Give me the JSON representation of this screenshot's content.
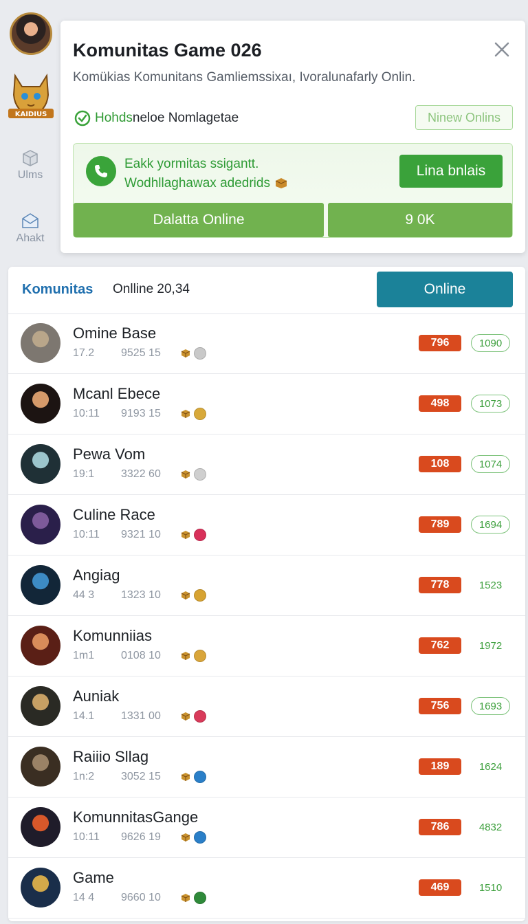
{
  "rail": {
    "items": [
      {
        "label": "Ulms",
        "icon": "box-icon"
      },
      {
        "label": "Ahakt",
        "icon": "envelope-icon"
      }
    ]
  },
  "popup": {
    "title": "Komunitas Game 026",
    "description": "Komükias Komunitans Gamliemssixaı, Ivoralunafarly Onlin.",
    "status_prefix": "Hohds",
    "status_text": "neloe Nomlagetae",
    "view_button": "Ninew Onlins",
    "inner_line1": "Eakk yormitas ssigantt.",
    "inner_line2": "Wodhllaghawax adedrids",
    "join_button": "Lina bnlais",
    "bar_button_1": "Dalatta Online",
    "bar_button_2": "9 0K"
  },
  "panel": {
    "title": "Komunitas",
    "count": "Onlline 20,34",
    "online_button": "Online"
  },
  "members": [
    {
      "name": "Omine Base",
      "m1": "17.2",
      "m2": "9525 15",
      "score": "796",
      "stat": "1090",
      "pill": true,
      "dot": "#c9c9c9",
      "av": [
        "#7d7770",
        "#b9a68a"
      ]
    },
    {
      "name": "Mcanl Ebece",
      "m1": "10:11",
      "m2": "9193 15",
      "score": "498",
      "stat": "1073",
      "pill": true,
      "dot": "#d8a93a",
      "av": [
        "#1c1412",
        "#d59a6a"
      ]
    },
    {
      "name": "Pewa Vom",
      "m1": "19:1",
      "m2": "3322 60",
      "score": "108",
      "stat": "1074",
      "pill": true,
      "dot": "#cfcfcf",
      "av": [
        "#1f3036",
        "#9cc5cc"
      ]
    },
    {
      "name": "Culine Race",
      "m1": "10:11",
      "m2": "9321 10",
      "score": "789",
      "stat": "1694",
      "pill": true,
      "dot": "#d8305a",
      "av": [
        "#2a1f4a",
        "#7d5a9a"
      ]
    },
    {
      "name": "Angiag",
      "m1": "44 3",
      "m2": "1323 10",
      "score": "778",
      "stat": "1523",
      "pill": false,
      "dot": "#d7a332",
      "av": [
        "#122638",
        "#3d8bc4"
      ]
    },
    {
      "name": "Komunniias",
      "m1": "1m1",
      "m2": "0108 10",
      "score": "762",
      "stat": "1972",
      "pill": false,
      "dot": "#d9a53a",
      "av": [
        "#5a1f16",
        "#d98c5a"
      ]
    },
    {
      "name": "Auniak",
      "m1": "14.1",
      "m2": "1331 00",
      "score": "756",
      "stat": "1693",
      "pill": true,
      "dot": "#d93a5a",
      "av": [
        "#2a2a24",
        "#c7a064"
      ]
    },
    {
      "name": "Raiiio Sllag",
      "m1": "1n:2",
      "m2": "3052 15",
      "score": "189",
      "stat": "1624",
      "pill": false,
      "dot": "#2a7fc8",
      "av": [
        "#3a2e22",
        "#9a8266"
      ]
    },
    {
      "name": "KomunnitasGange",
      "m1": "10:11",
      "m2": "9626 19",
      "score": "786",
      "stat": "4832",
      "pill": false,
      "dot": "#2a7fc8",
      "av": [
        "#1f1c2a",
        "#d8582a"
      ]
    },
    {
      "name": "Game",
      "m1": "14 4",
      "m2": "9660 10",
      "score": "469",
      "stat": "1510",
      "pill": false,
      "dot": "#2f8a3a",
      "av": [
        "#1a2e4a",
        "#d3a94a"
      ]
    }
  ],
  "colors": {
    "accent_blue": "#1f6fae",
    "online_button": "#1b8299",
    "green": "#3aa23a",
    "score_red": "#d94a1e"
  }
}
